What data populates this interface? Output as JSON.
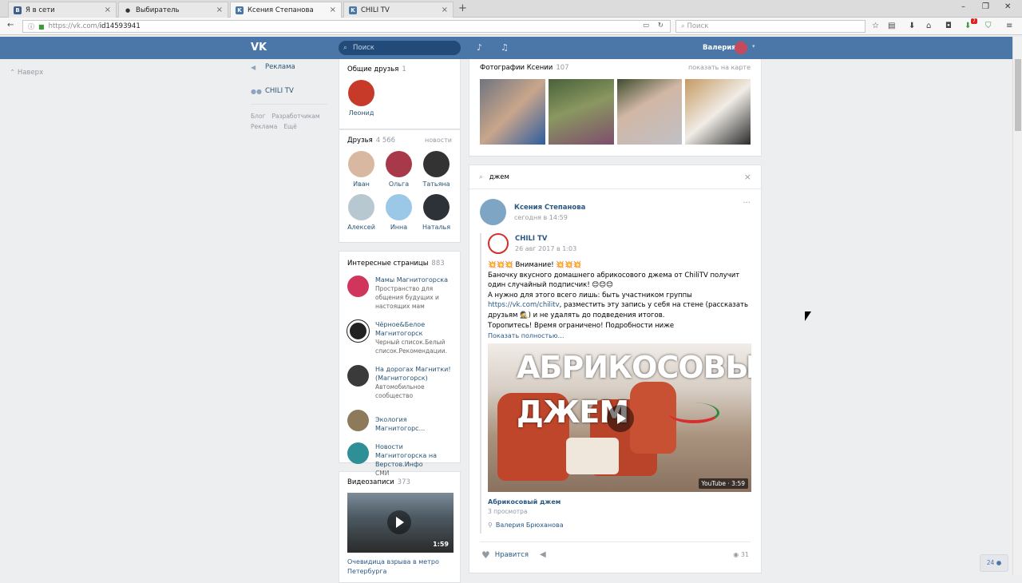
{
  "browser": {
    "tabs": [
      {
        "label": "Я в сети",
        "favicon": "B"
      },
      {
        "label": "Выбиратель",
        "favicon": "paw"
      },
      {
        "label": "Ксения Степанова",
        "favicon": "VK"
      },
      {
        "label": "CHILI TV",
        "favicon": "VK"
      }
    ],
    "url_host": "https://vk.com/",
    "url_path": "id14593941",
    "search_placeholder": "Поиск",
    "notif_badge": "7"
  },
  "vk_header": {
    "search_placeholder": "Поиск",
    "user_name": "Валерия"
  },
  "left_menu": {
    "up_label": "Наверх",
    "items": [
      {
        "label": "Реклама"
      },
      {
        "label": "CHILI TV"
      }
    ],
    "footer_links": [
      "Блог",
      "Разработчикам",
      "Реклама",
      "Ещё"
    ]
  },
  "mutual_friends": {
    "title": "Общие друзья",
    "count": "1",
    "items": [
      {
        "name": "Леонид"
      }
    ]
  },
  "friends": {
    "title": "Друзья",
    "count": "4 566",
    "more": "новости",
    "items": [
      {
        "name": "Иван"
      },
      {
        "name": "Ольга"
      },
      {
        "name": "Татьяна"
      },
      {
        "name": "Алексей"
      },
      {
        "name": "Инна"
      },
      {
        "name": "Наталья"
      }
    ]
  },
  "interesting_pages": {
    "title": "Интересные страницы",
    "count": "883",
    "items": [
      {
        "name": "Мамы Магнитогорска",
        "desc": "Пространство для общения будущих и настоящих мам"
      },
      {
        "name": "Чёрное&Белое Магнитогорск",
        "desc": "Черный список.Белый список.Рекомендации."
      },
      {
        "name": "На дорогах Магнитки! (Магнитогорск)",
        "desc": "Автомобильное сообщество"
      },
      {
        "name": "Экология Магнитогорс...",
        "desc": ""
      },
      {
        "name": "Новости Магнитогорска на Верстов.Инфо",
        "desc": "СМИ"
      }
    ]
  },
  "videos": {
    "title": "Видеозаписи",
    "count": "373",
    "duration": "1:59",
    "caption": "Очевидица взрыва в метро Петербурга"
  },
  "photos": {
    "title": "Фотографии Ксении",
    "count": "107",
    "map_link": "показать на карте"
  },
  "wall_search": {
    "query": "джем"
  },
  "post": {
    "author": "Ксения Степанова",
    "date": "сегодня в 14:59",
    "repost_author": "CHILI TV",
    "repost_date": "26 авг 2017 в 1:03",
    "line1": "💥💥💥 Внимание! 💥💥💥",
    "line2": "Баночку вкусного домашнего абрикосового джема от ChiliTV получит один случайный подписчик! 😊😊😊",
    "line3": "А нужно для этого всего лишь: быть участником группы",
    "link": "https://vk.com/chilitv",
    "line4": ", разместить эту запись у себя на стене (рассказать друзьям 🕵) и не удалять до подведения итогов.",
    "line5": "Торопитесь! Время ограничено! Подробности ниже",
    "show_more": "Показать полностью…",
    "video_title_1": "АБРИКОСОВЫЙ",
    "video_title_2": "ДЖЕМ",
    "video_badge": "YouTube · 3:59",
    "video_name": "Абрикосовый джем",
    "video_views": "3 просмотра",
    "video_author": "Валерия Брюханова",
    "like_label": "Нравится",
    "views_count": "31"
  },
  "corner_counter": "24"
}
